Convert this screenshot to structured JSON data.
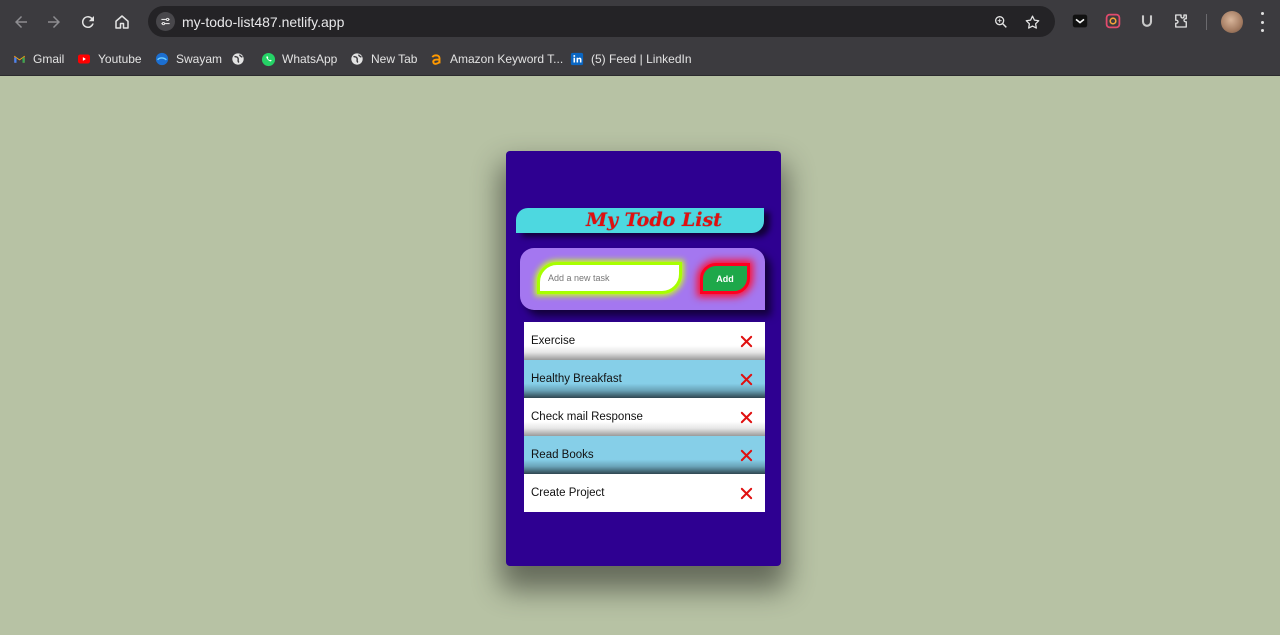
{
  "browser": {
    "url": "my-todo-list487.netlify.app",
    "bookmarks": [
      {
        "label": "Gmail",
        "icon": "gmail-icon"
      },
      {
        "label": "Youtube",
        "icon": "youtube-icon"
      },
      {
        "label": "Swayam",
        "icon": "swayam-icon"
      },
      {
        "label": "",
        "icon": "globe-icon"
      },
      {
        "label": "WhatsApp",
        "icon": "whatsapp-icon"
      },
      {
        "label": "New Tab",
        "icon": "globe-icon"
      },
      {
        "label": "Amazon Keyword T...",
        "icon": "amazon-icon"
      },
      {
        "label": "(5) Feed | LinkedIn",
        "icon": "linkedin-icon"
      }
    ]
  },
  "app": {
    "title": "My Todo List",
    "input_placeholder": "Add a new task",
    "add_label": "Add",
    "tasks": [
      {
        "label": "Exercise"
      },
      {
        "label": "Healthy Breakfast"
      },
      {
        "label": "Check mail Response"
      },
      {
        "label": "Read Books"
      },
      {
        "label": "Create Project"
      }
    ]
  },
  "colors": {
    "page_bg": "#b7c2a4",
    "card_bg": "#2e0091",
    "title_bg": "#4dd8e0",
    "title_text": "#e01010",
    "add_area_bg": "#a477f0",
    "input_border": "#a7ff00",
    "add_button_bg": "#1ea84a",
    "add_button_border": "#ff0020",
    "alt_row_bg": "#86cfe8",
    "delete_icon": "#e01010"
  }
}
